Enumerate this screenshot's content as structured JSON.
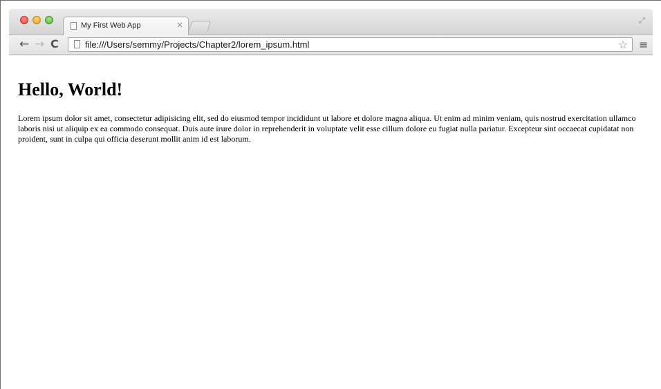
{
  "tab": {
    "title": "My First Web App",
    "close": "×"
  },
  "toolbar": {
    "back": "←",
    "forward": "→",
    "reload": "C",
    "url": "file:///Users/semmy/Projects/Chapter2/lorem_ipsum.html",
    "star": "☆",
    "menu": "≡"
  },
  "page": {
    "heading": "Hello, World!",
    "paragraph": "Lorem ipsum dolor sit amet, consectetur adipisicing elit, sed do eiusmod tempor incididunt ut labore et dolore magna aliqua. Ut enim ad minim veniam, quis nostrud exercitation ullamco laboris nisi ut aliquip ex ea commodo consequat. Duis aute irure dolor in reprehenderit in voluptate velit esse cillum dolore eu fugiat nulla pariatur. Excepteur sint occaecat cupidatat non proident, sunt in culpa qui officia deserunt mollit anim id est laborum."
  },
  "icons": {
    "window_close": "close-button",
    "window_minimize": "minimize-button",
    "window_zoom": "zoom-button",
    "fullscreen": "fullscreen-icon"
  }
}
